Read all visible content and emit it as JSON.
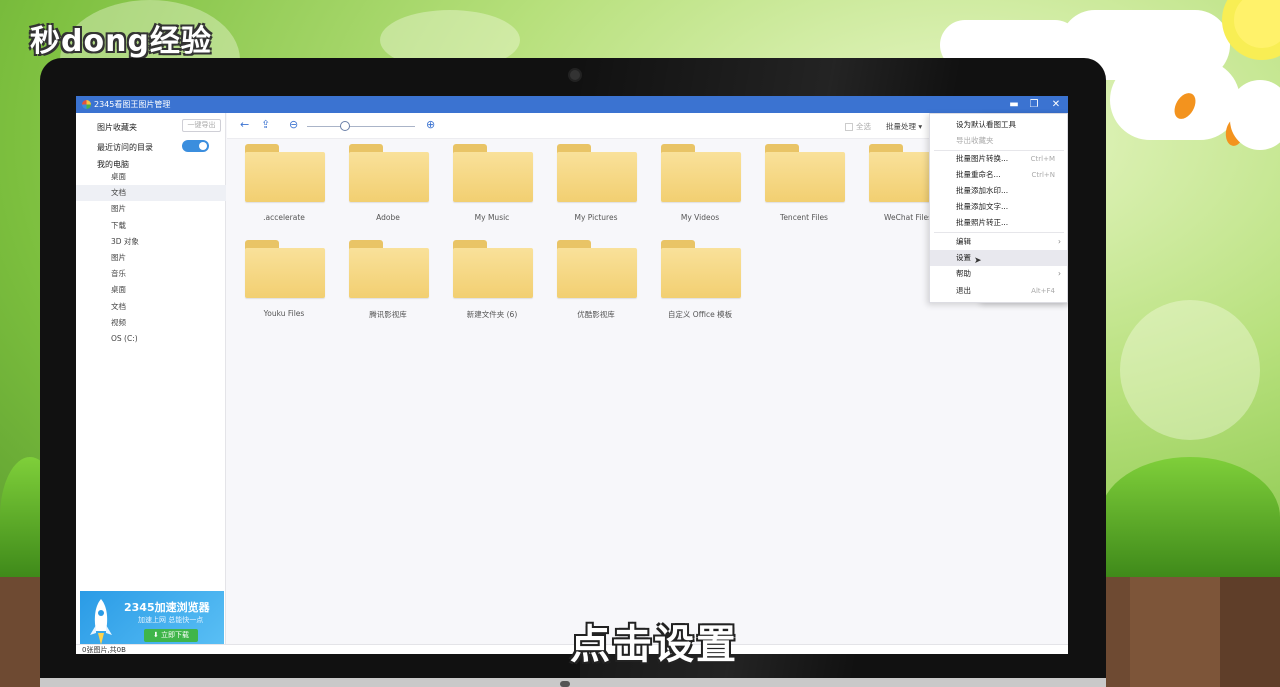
{
  "watermark": {
    "text": "秒dong经验"
  },
  "caption": {
    "text": "点击设置"
  },
  "window": {
    "title": "2345看图王图片管理",
    "buttons": {
      "menu_icon": "dropdown-triangle-icon",
      "minimize_icon": "minimize-icon",
      "maximize_icon": "restore-icon",
      "close_icon": "close-icon"
    }
  },
  "sidebar": {
    "favorites_label": "图片收藏夹",
    "export_button": "一键导出",
    "recent_label": "最近访问的目录",
    "recent_toggle_on": true,
    "my_computer_label": "我的电脑",
    "tree": [
      {
        "label": "桌面"
      },
      {
        "label": "文档",
        "selected": true
      },
      {
        "label": "图片"
      },
      {
        "label": "下载"
      },
      {
        "label": "3D 对象"
      },
      {
        "label": "图片"
      },
      {
        "label": "音乐"
      },
      {
        "label": "桌面"
      },
      {
        "label": "文档"
      },
      {
        "label": "视频"
      },
      {
        "label": "OS (C:)"
      }
    ],
    "ad": {
      "title": "2345加速浏览器",
      "subtitle": "加速上网 总能快一点",
      "button": "立即下载"
    }
  },
  "toolbar": {
    "back_icon": "arrow-left-icon",
    "upload_icon": "upload-icon",
    "zoom_out_icon": "zoom-out-icon",
    "zoom_in_icon": "zoom-in-icon",
    "zoom_level": 0.3,
    "select_all": "全选",
    "batch": "批量处理 ▾"
  },
  "folders": [
    {
      "name": ".accelerate"
    },
    {
      "name": "Adobe"
    },
    {
      "name": "My Music"
    },
    {
      "name": "My Pictures"
    },
    {
      "name": "My Videos"
    },
    {
      "name": "Tencent Files"
    },
    {
      "name": "WeChat Files"
    },
    {
      "name": "Youku Files"
    },
    {
      "name": "腾讯影视库"
    },
    {
      "name": "新建文件夹 (6)"
    },
    {
      "name": "优酷影视库"
    },
    {
      "name": "自定义 Office 模板"
    }
  ],
  "menu": {
    "items": [
      {
        "label": "设为默认看图工具",
        "shortcut": "",
        "disabled": false
      },
      {
        "label": "导出收藏夹",
        "shortcut": "",
        "disabled": true
      },
      {
        "label": "批量图片转换...",
        "shortcut": "Ctrl+M",
        "disabled": false
      },
      {
        "label": "批量重命名...",
        "shortcut": "Ctrl+N",
        "disabled": false
      },
      {
        "label": "批量添加水印...",
        "shortcut": "",
        "disabled": false
      },
      {
        "label": "批量添加文字...",
        "shortcut": "",
        "disabled": false
      },
      {
        "label": "批量照片转正...",
        "shortcut": "",
        "disabled": false
      },
      {
        "label": "编辑",
        "shortcut": "",
        "submenu": true
      },
      {
        "label": "设置",
        "shortcut": "",
        "hover": true
      },
      {
        "label": "帮助",
        "shortcut": "",
        "submenu": true
      },
      {
        "label": "退出",
        "shortcut": "Alt+F4"
      }
    ]
  },
  "status": {
    "text": "0张图片,共0B"
  },
  "colors": {
    "titlebar": "#3b73d1",
    "accent": "#3b8ede",
    "folder": "#f2cf71"
  }
}
